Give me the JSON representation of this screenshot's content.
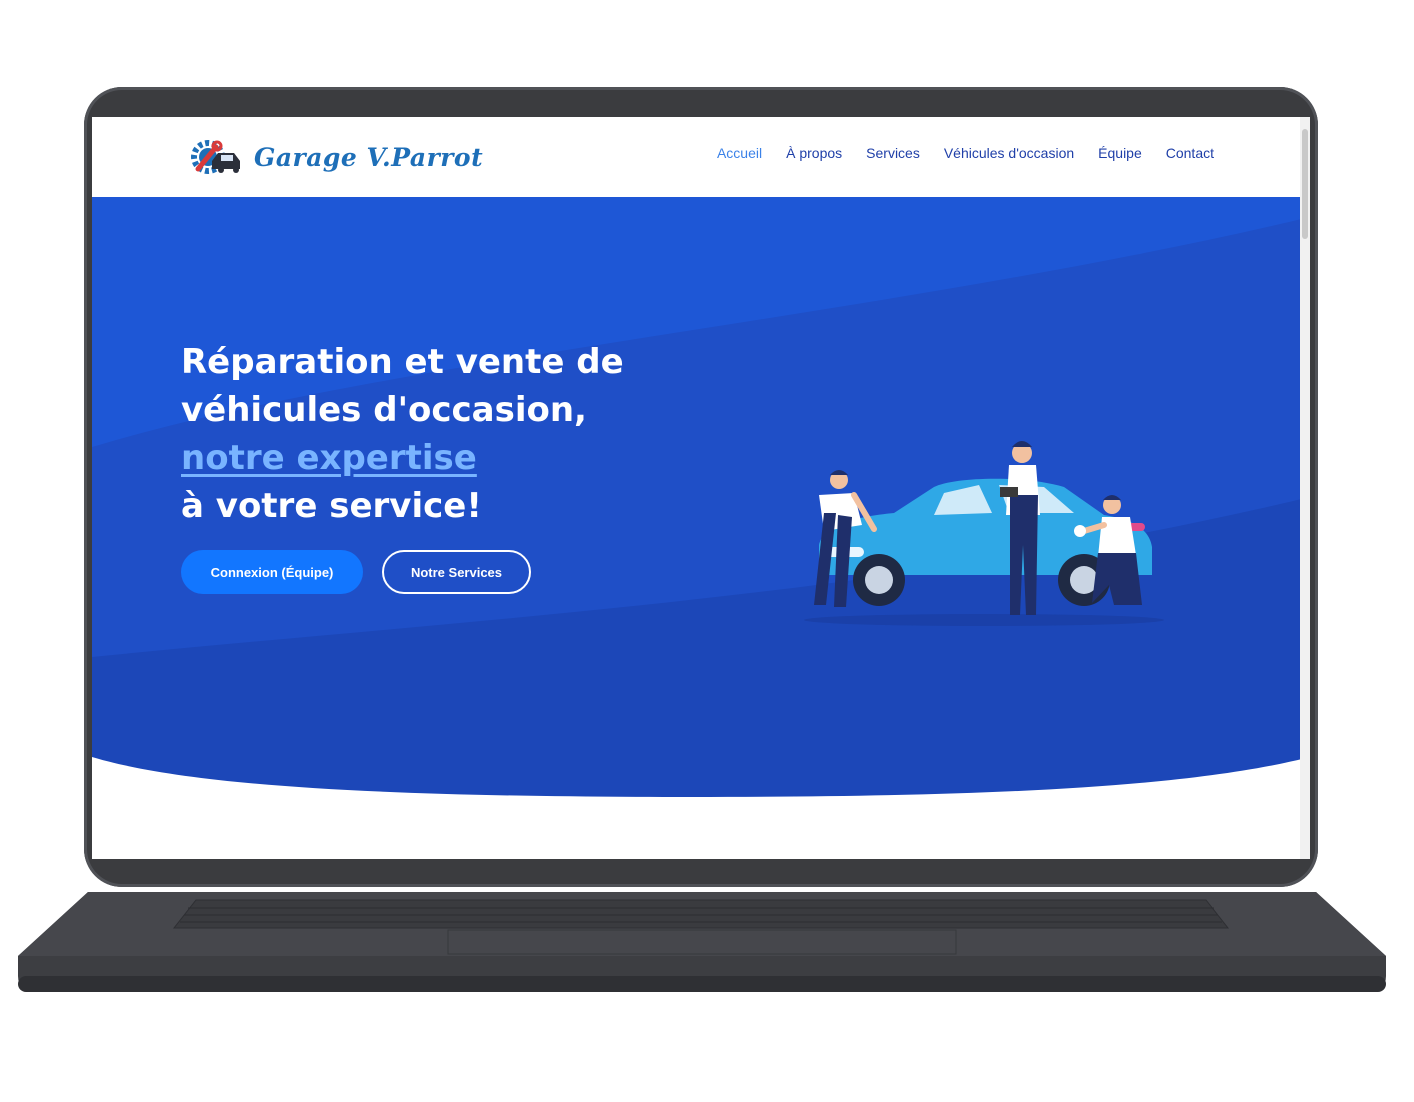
{
  "brand": {
    "name": "Garage V.Parrot"
  },
  "nav": {
    "items": [
      {
        "label": "Accueil",
        "active": true
      },
      {
        "label": "À propos"
      },
      {
        "label": "Services"
      },
      {
        "label": "Véhicules d'occasion"
      },
      {
        "label": "Équipe"
      },
      {
        "label": "Contact"
      }
    ]
  },
  "hero": {
    "title_line1": "Réparation et vente de",
    "title_line2": "véhicules d'occasion,",
    "title_highlight": "notre expertise",
    "title_line4": "à votre service!",
    "primary_button": "Connexion (Équipe)",
    "secondary_button": "Notre Services"
  },
  "colors": {
    "hero_blue": "#1f4fc7",
    "accent_blue": "#1276ff",
    "highlight_text": "#79b4ff",
    "brand_text": "#1e6fb8"
  },
  "icons": {
    "logo": "gear-wrench-car-icon",
    "illustration": "mechanics-car-illustration"
  }
}
